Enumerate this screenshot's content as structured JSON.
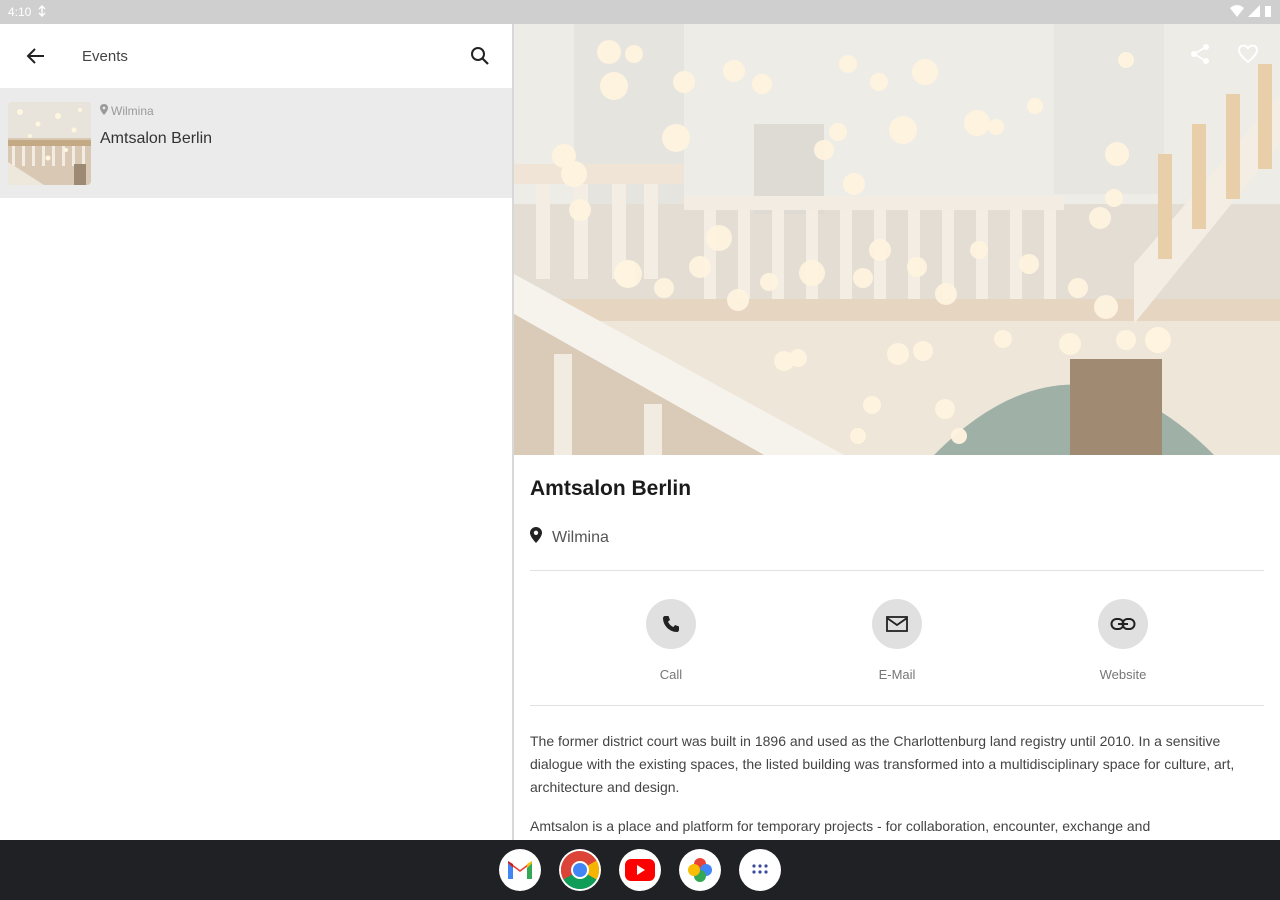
{
  "status_bar": {
    "time": "4:10"
  },
  "list_pane": {
    "title": "Events",
    "items": [
      {
        "location": "Wilmina",
        "title": "Amtsalon Berlin"
      }
    ]
  },
  "detail": {
    "title": "Amtsalon Berlin",
    "location": "Wilmina",
    "actions": {
      "call": "Call",
      "email": "E-Mail",
      "website": "Website"
    },
    "description": [
      "The former district court was built in 1896 and used as the Charlottenburg land registry until 2010. In a sensitive dialogue with the existing spaces, the listed building was transformed into a multidisciplinary space for culture, art, architecture and design.",
      "Amtsalon is a place and platform for temporary projects - for collaboration, encounter, exchange and"
    ]
  },
  "colors": {
    "status_bar": "#cfcfcf",
    "selected_item": "#ebebeb",
    "action_circle": "#e0e0e0",
    "nav_bar": "#202124"
  },
  "icons": [
    "back-arrow-icon",
    "search-icon",
    "location-pin-icon",
    "share-icon",
    "heart-icon",
    "phone-icon",
    "mail-icon",
    "link-icon",
    "gmail-icon",
    "chrome-icon",
    "youtube-icon",
    "photos-icon",
    "app-drawer-icon"
  ]
}
